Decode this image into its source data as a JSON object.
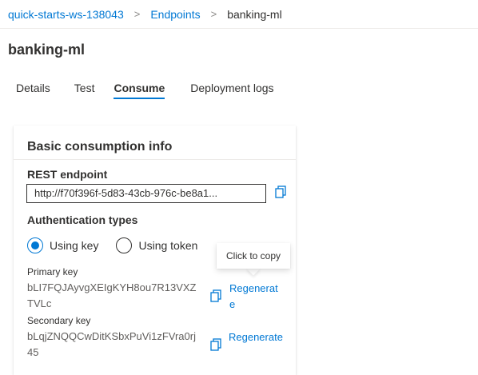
{
  "breadcrumb": {
    "items": [
      "quick-starts-ws-138043",
      "Endpoints",
      "banking-ml"
    ],
    "separator": ">"
  },
  "page": {
    "title": "banking-ml"
  },
  "tabs": [
    {
      "label": "Details",
      "active": false
    },
    {
      "label": "Test",
      "active": false
    },
    {
      "label": "Consume",
      "active": true
    },
    {
      "label": "Deployment logs",
      "active": false
    }
  ],
  "card": {
    "title": "Basic consumption info",
    "rest_endpoint_label": "REST endpoint",
    "rest_endpoint_value": "http://f70f396f-5d83-43cb-976c-be8a1...",
    "auth_types_label": "Authentication types",
    "auth_options": [
      {
        "label": "Using key",
        "selected": true
      },
      {
        "label": "Using token",
        "selected": false
      }
    ],
    "primary_key_label": "Primary key",
    "primary_key_value": "bLI7FQJAyvgXEIgKYH8ou7R13VXZTVLc",
    "primary_regen_label": "Regenerate",
    "secondary_key_label": "Secondary key",
    "secondary_key_value": "bLqjZNQQCwDitKSbxPuVi1zFVra0rj45",
    "secondary_regen_label": "Regenerate"
  },
  "tooltip": {
    "text": "Click to copy"
  },
  "colors": {
    "accent": "#0078d4",
    "text": "#323130",
    "muted": "#605e5c"
  },
  "icons": {
    "copy": "copy-icon",
    "regenerate": "regenerate-icon"
  }
}
